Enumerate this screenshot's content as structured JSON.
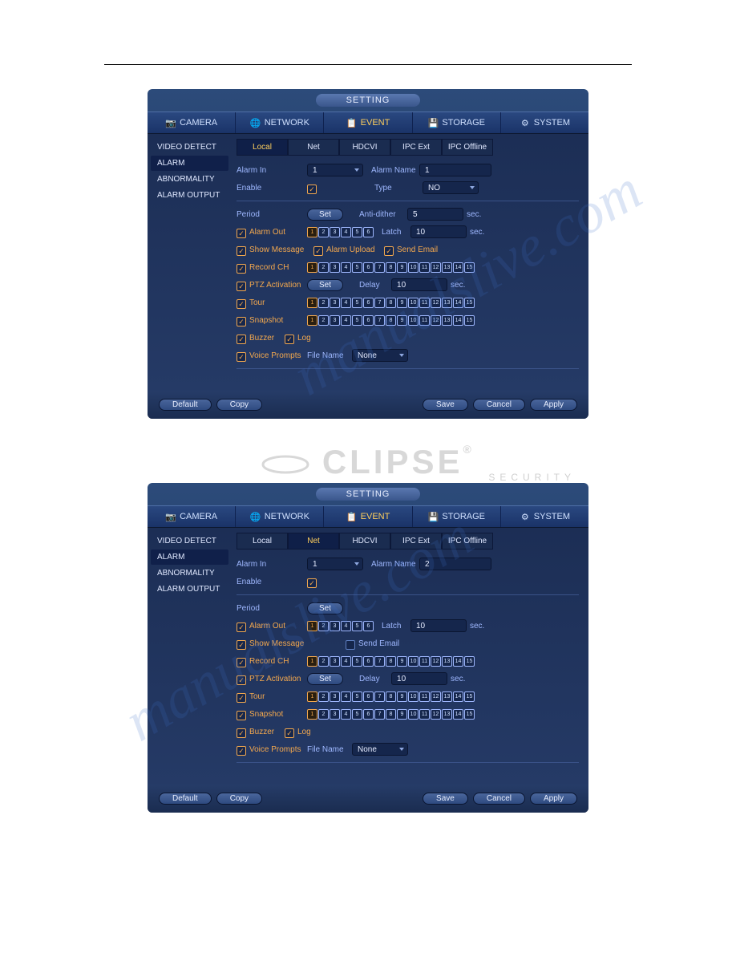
{
  "title": "SETTING",
  "topnav": [
    "CAMERA",
    "NETWORK",
    "EVENT",
    "STORAGE",
    "SYSTEM"
  ],
  "topnav_active": 2,
  "sidebar": [
    "VIDEO DETECT",
    "ALARM",
    "ABNORMALITY",
    "ALARM OUTPUT"
  ],
  "sidebar_active": 1,
  "subtabs": [
    "Local",
    "Net",
    "HDCVI",
    "IPC Ext",
    "IPC Offline"
  ],
  "labels": {
    "alarm_in": "Alarm In",
    "alarm_name": "Alarm Name",
    "enable": "Enable",
    "type": "Type",
    "period": "Period",
    "set": "Set",
    "anti_dither": "Anti-dither",
    "sec": "sec.",
    "alarm_out": "Alarm Out",
    "latch": "Latch",
    "show_message": "Show Message",
    "alarm_upload": "Alarm Upload",
    "send_email": "Send Email",
    "record_ch": "Record CH",
    "ptz_activation": "PTZ Activation",
    "delay": "Delay",
    "tour": "Tour",
    "snapshot": "Snapshot",
    "buzzer": "Buzzer",
    "log": "Log",
    "voice_prompts": "Voice Prompts",
    "file_name": "File Name",
    "none": "None",
    "default": "Default",
    "copy": "Copy",
    "save": "Save",
    "cancel": "Cancel",
    "apply": "Apply"
  },
  "panel1": {
    "subtab_active": 0,
    "alarm_in": "1",
    "alarm_name": "1",
    "enable": true,
    "type": "NO",
    "anti_dither": "5",
    "alarm_out_checked": true,
    "alarm_out_channels": [
      true,
      false,
      false,
      false,
      false,
      false
    ],
    "latch": "10",
    "show_message": true,
    "alarm_upload": true,
    "send_email": true,
    "record_ch": true,
    "record_channels_on": [
      1
    ],
    "record_channels_count": 15,
    "ptz_activation": true,
    "delay": "10",
    "tour": true,
    "tour_channels_on": [
      1
    ],
    "tour_channels_count": 15,
    "snapshot": true,
    "snapshot_channels_on": [
      1
    ],
    "snapshot_channels_count": 15,
    "buzzer": true,
    "log": true,
    "voice_prompts": true,
    "file_name": "None"
  },
  "panel2": {
    "subtab_active": 1,
    "alarm_in": "1",
    "alarm_name": "2",
    "enable": true,
    "alarm_out_checked": true,
    "alarm_out_channels": [
      true,
      false,
      false,
      false,
      false,
      false
    ],
    "latch": "10",
    "show_message": true,
    "send_email": false,
    "record_ch": true,
    "record_channels_on": [
      1
    ],
    "record_channels_count": 15,
    "ptz_activation": true,
    "delay": "10",
    "tour": true,
    "tour_channels_on": [
      1
    ],
    "tour_channels_count": 15,
    "snapshot": true,
    "snapshot_channels_on": [
      1
    ],
    "snapshot_channels_count": 15,
    "buzzer": true,
    "log": true,
    "voice_prompts": true,
    "file_name": "None"
  },
  "watermark": {
    "brand": "CLIPSE",
    "reg": "®",
    "security": "SECURITY",
    "diag": "manualslive.com"
  }
}
